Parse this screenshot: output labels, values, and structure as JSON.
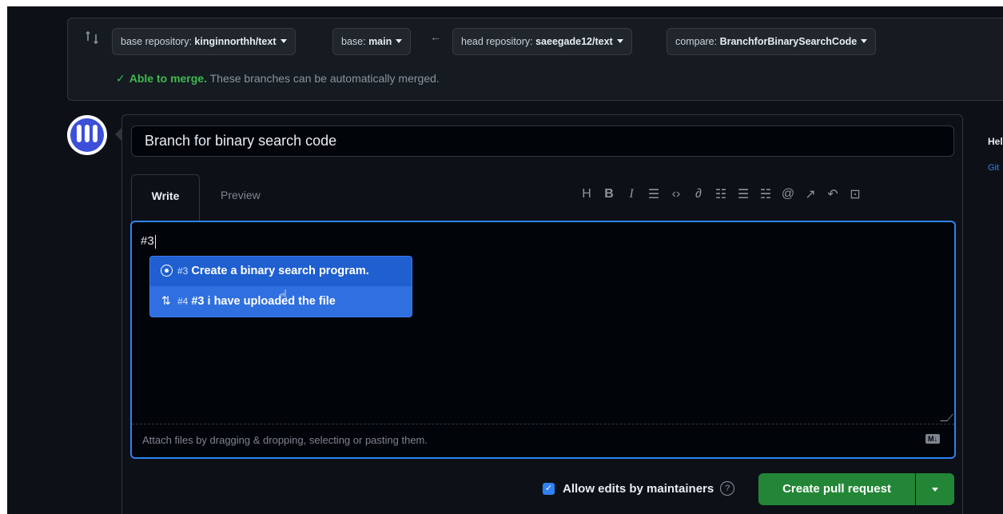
{
  "compare": {
    "base_repo_label": "base repository: ",
    "base_repo_value": "kinginnorthh/text",
    "base_label": "base: ",
    "base_value": "main",
    "head_repo_label": "head repository: ",
    "head_repo_value": "saeegade12/text",
    "compare_label": "compare: ",
    "compare_value": "BranchforBinarySearchCode",
    "merge_status": "Able to merge.",
    "merge_message": " These branches can be automatically merged."
  },
  "form": {
    "title_value": "Branch for binary search code",
    "tab_write": "Write",
    "tab_preview": "Preview",
    "toolbar_icons": [
      "heading-icon",
      "bold-icon",
      "italic-icon",
      "quote-icon",
      "code-icon",
      "link-icon",
      "unordered-list-icon",
      "ordered-list-icon",
      "task-list-icon",
      "mention-icon",
      "reference-icon",
      "reply-icon",
      "fullscreen-icon"
    ],
    "body_text": "#3",
    "attach_hint": "Attach files by dragging & dropping, selecting or pasting them.",
    "markdown_badge": "M↓"
  },
  "suggestions": [
    {
      "num": "#3",
      "text": "Create a binary search program.",
      "icon": "issue-icon"
    },
    {
      "num": "#4",
      "text": "#3 i have uploaded the file",
      "icon": "pull-request-icon"
    }
  ],
  "actions": {
    "allow_edits": "Allow edits by maintainers",
    "create_button": "Create pull request"
  },
  "sidebar": {
    "help_title": "Hel",
    "help_link": "Git"
  },
  "colors": {
    "accent": "#2f81f7",
    "success": "#238636",
    "background": "#0d1117"
  }
}
